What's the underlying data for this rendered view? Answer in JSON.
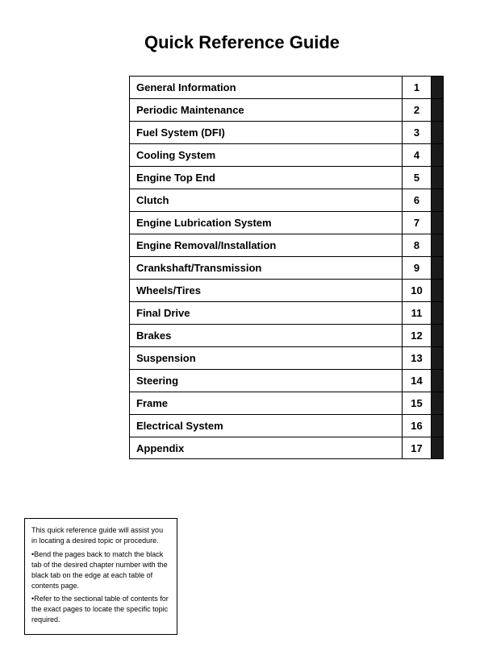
{
  "title": "Quick Reference Guide",
  "items": [
    {
      "label": "General Information",
      "number": "1"
    },
    {
      "label": "Periodic Maintenance",
      "number": "2"
    },
    {
      "label": "Fuel System (DFI)",
      "number": "3"
    },
    {
      "label": "Cooling System",
      "number": "4"
    },
    {
      "label": "Engine Top End",
      "number": "5"
    },
    {
      "label": "Clutch",
      "number": "6"
    },
    {
      "label": "Engine Lubrication System",
      "number": "7"
    },
    {
      "label": "Engine Removal/Installation",
      "number": "8"
    },
    {
      "label": "Crankshaft/Transmission",
      "number": "9"
    },
    {
      "label": "Wheels/Tires",
      "number": "10"
    },
    {
      "label": "Final Drive",
      "number": "11"
    },
    {
      "label": "Brakes",
      "number": "12"
    },
    {
      "label": "Suspension",
      "number": "13"
    },
    {
      "label": "Steering",
      "number": "14"
    },
    {
      "label": "Frame",
      "number": "15"
    },
    {
      "label": "Electrical System",
      "number": "16"
    },
    {
      "label": "Appendix",
      "number": "17"
    }
  ],
  "note": {
    "line1": "This quick reference guide will assist you in locating a desired topic or procedure.",
    "bullet1": "•Bend the pages back to match the black tab of the desired chapter number with the black tab on the edge at each table of contents page.",
    "bullet2": "•Refer to the sectional table of contents for the exact pages to locate the specific topic required."
  }
}
